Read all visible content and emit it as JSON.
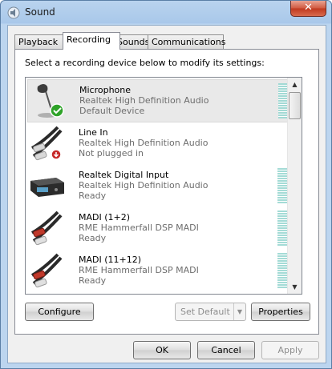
{
  "window": {
    "title": "Sound",
    "close_glyph": "✕"
  },
  "tabs": [
    {
      "label": "Playback",
      "active": false
    },
    {
      "label": "Recording",
      "active": true
    },
    {
      "label": "Sounds",
      "active": false
    },
    {
      "label": "Communications",
      "active": false
    }
  ],
  "instruction": "Select a recording device below to modify its settings:",
  "devices": [
    {
      "name": "Microphone",
      "driver": "Realtek High Definition Audio",
      "status": "Default Device",
      "icon": "microphone-icon",
      "badge": "default-check",
      "selected": true
    },
    {
      "name": "Line In",
      "driver": "Realtek High Definition Audio",
      "status": "Not plugged in",
      "icon": "rca-cable-icon",
      "badge": "unplugged-arrow"
    },
    {
      "name": "Realtek Digital Input",
      "driver": "Realtek High Definition Audio",
      "status": "Ready",
      "icon": "digital-input-box-icon"
    },
    {
      "name": "MADI (1+2)",
      "driver": "RME Hammerfall DSP MADI",
      "status": "Ready",
      "icon": "rca-cable-icon"
    },
    {
      "name": "MADI (11+12)",
      "driver": "RME Hammerfall DSP MADI",
      "status": "Ready",
      "icon": "rca-cable-icon"
    }
  ],
  "buttons": {
    "configure": "Configure",
    "set_default": "Set Default",
    "properties": "Properties",
    "ok": "OK",
    "cancel": "Cancel",
    "apply": "Apply"
  },
  "colors": {
    "close_red": "#c0391f",
    "level_meter": "#9ad7d2",
    "check_green": "#2fa329",
    "unplug_red": "#c62828"
  }
}
